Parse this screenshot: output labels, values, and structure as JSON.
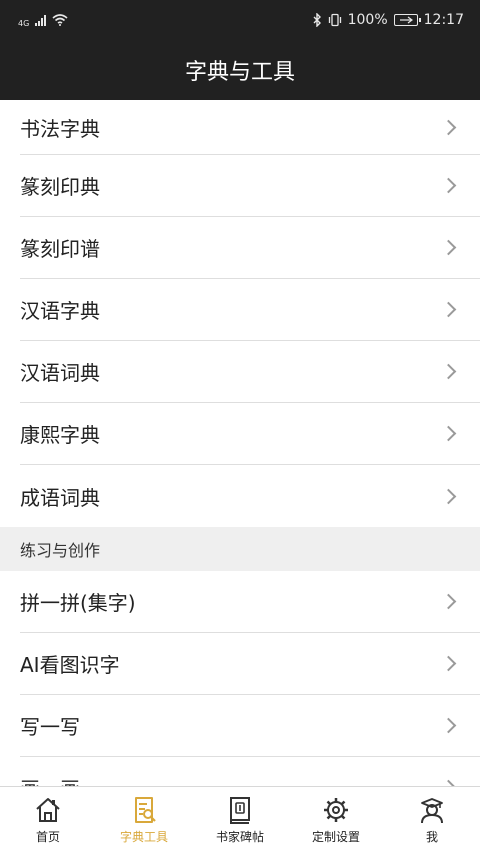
{
  "status_bar": {
    "network": "4G",
    "battery_percent": "100%",
    "time": "12:17"
  },
  "header": {
    "title": "字典与工具"
  },
  "dictionaries": [
    {
      "label": "书法字典"
    },
    {
      "label": "篆刻印典"
    },
    {
      "label": "篆刻印谱"
    },
    {
      "label": "汉语字典"
    },
    {
      "label": "汉语词典"
    },
    {
      "label": "康熙字典"
    },
    {
      "label": "成语词典"
    }
  ],
  "practice": {
    "section_title": "练习与创作",
    "items": [
      {
        "label": "拼一拼(集字)"
      },
      {
        "label": "AI看图识字"
      },
      {
        "label": "写一写"
      },
      {
        "label": "画一画"
      }
    ]
  },
  "tab_bar": {
    "active_color": "#d9a83a",
    "tabs": [
      {
        "label": "首页",
        "icon": "home-icon"
      },
      {
        "label": "字典工具",
        "icon": "dictionary-icon"
      },
      {
        "label": "书家碑帖",
        "icon": "book-icon"
      },
      {
        "label": "定制设置",
        "icon": "gear-icon"
      },
      {
        "label": "我",
        "icon": "user-icon"
      }
    ]
  }
}
